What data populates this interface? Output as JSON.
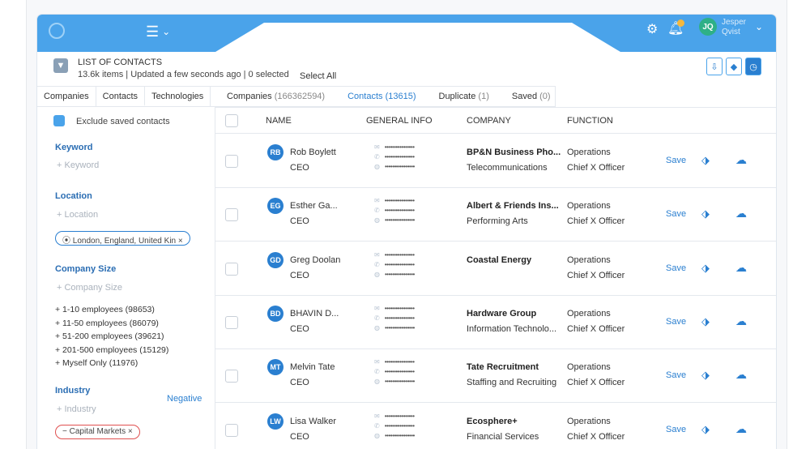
{
  "topbar": {
    "menu_icon": "hamburger-icon",
    "user_initials": "JQ",
    "user_first": "Jesper",
    "user_last": "Qvist",
    "accent": "#4aa3ea"
  },
  "header": {
    "title": "LIST OF CONTACTS",
    "meta": "13.6k items  |  Updated a few seconds ago  |  0 selected",
    "select_all": "Select All"
  },
  "left_tabs": [
    "Companies",
    "Contacts",
    "Technologies"
  ],
  "right_tabs": [
    {
      "label": "Companies",
      "count": "(166362594)"
    },
    {
      "label": "Contacts",
      "count": "(13615)"
    },
    {
      "label": "Duplicate",
      "count": "(1)"
    },
    {
      "label": "Saved",
      "count": "(0)"
    }
  ],
  "sidebar": {
    "exclude_label": "Exclude saved contacts",
    "keyword": {
      "title": "Keyword",
      "add": "+  Keyword"
    },
    "location": {
      "title": "Location",
      "add": "+  Location",
      "chip": "London, England, United Kin"
    },
    "company_size": {
      "title": "Company Size",
      "add": "+  Company Size",
      "options": [
        "+  1-10 employees (98653)",
        "+  11-50 employees (86079)",
        "+  51-200 employees (39621)",
        "+  201-500 employees (15129)",
        "+  Myself Only (11976)"
      ]
    },
    "industry": {
      "title": "Industry",
      "negative": "Negative",
      "add": "+  Industry",
      "chip": "− Capital Markets"
    }
  },
  "table": {
    "columns": [
      "NAME",
      "GENERAL INFO",
      "COMPANY",
      "FUNCTION"
    ],
    "masked": "••••••••••••••••",
    "save_label": "Save",
    "rows": [
      {
        "initials": "RB",
        "name": "Rob Boylett",
        "title": "CEO",
        "company": "BP&N Business Pho...",
        "industry": "Telecommunications",
        "function": "Operations",
        "level": "Chief X Officer"
      },
      {
        "initials": "EG",
        "name": "Esther Ga...",
        "title": "CEO",
        "company": "Albert & Friends Ins...",
        "industry": "Performing Arts",
        "function": "Operations",
        "level": "Chief X Officer"
      },
      {
        "initials": "GD",
        "name": "Greg Doolan",
        "title": "CEO",
        "company": "Coastal Energy",
        "industry": "",
        "function": "Operations",
        "level": "Chief X Officer"
      },
      {
        "initials": "BD",
        "name": "BHAVIN D...",
        "title": "CEO",
        "company": "Hardware Group",
        "industry": "Information Technolo...",
        "function": "Operations",
        "level": "Chief X Officer"
      },
      {
        "initials": "MT",
        "name": "Melvin Tate",
        "title": "CEO",
        "company": "Tate Recruitment",
        "industry": "Staffing and Recruiting",
        "function": "Operations",
        "level": "Chief X Officer"
      },
      {
        "initials": "LW",
        "name": "Lisa Walker",
        "title": "CEO",
        "company": "Ecosphere+",
        "industry": "Financial Services",
        "function": "Operations",
        "level": "Chief X Officer"
      }
    ]
  }
}
